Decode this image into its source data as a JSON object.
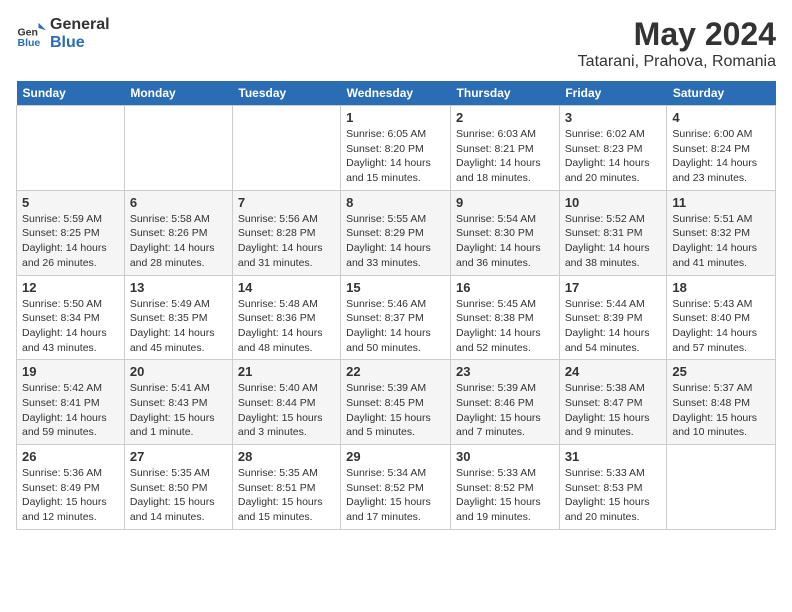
{
  "app": {
    "logo_general": "General",
    "logo_blue": "Blue",
    "title": "May 2024",
    "subtitle": "Tatarani, Prahova, Romania"
  },
  "calendar": {
    "headers": [
      "Sunday",
      "Monday",
      "Tuesday",
      "Wednesday",
      "Thursday",
      "Friday",
      "Saturday"
    ],
    "weeks": [
      [
        {
          "day": "",
          "sunrise": "",
          "sunset": "",
          "daylight": ""
        },
        {
          "day": "",
          "sunrise": "",
          "sunset": "",
          "daylight": ""
        },
        {
          "day": "",
          "sunrise": "",
          "sunset": "",
          "daylight": ""
        },
        {
          "day": "1",
          "sunrise": "Sunrise: 6:05 AM",
          "sunset": "Sunset: 8:20 PM",
          "daylight": "Daylight: 14 hours and 15 minutes."
        },
        {
          "day": "2",
          "sunrise": "Sunrise: 6:03 AM",
          "sunset": "Sunset: 8:21 PM",
          "daylight": "Daylight: 14 hours and 18 minutes."
        },
        {
          "day": "3",
          "sunrise": "Sunrise: 6:02 AM",
          "sunset": "Sunset: 8:23 PM",
          "daylight": "Daylight: 14 hours and 20 minutes."
        },
        {
          "day": "4",
          "sunrise": "Sunrise: 6:00 AM",
          "sunset": "Sunset: 8:24 PM",
          "daylight": "Daylight: 14 hours and 23 minutes."
        }
      ],
      [
        {
          "day": "5",
          "sunrise": "Sunrise: 5:59 AM",
          "sunset": "Sunset: 8:25 PM",
          "daylight": "Daylight: 14 hours and 26 minutes."
        },
        {
          "day": "6",
          "sunrise": "Sunrise: 5:58 AM",
          "sunset": "Sunset: 8:26 PM",
          "daylight": "Daylight: 14 hours and 28 minutes."
        },
        {
          "day": "7",
          "sunrise": "Sunrise: 5:56 AM",
          "sunset": "Sunset: 8:28 PM",
          "daylight": "Daylight: 14 hours and 31 minutes."
        },
        {
          "day": "8",
          "sunrise": "Sunrise: 5:55 AM",
          "sunset": "Sunset: 8:29 PM",
          "daylight": "Daylight: 14 hours and 33 minutes."
        },
        {
          "day": "9",
          "sunrise": "Sunrise: 5:54 AM",
          "sunset": "Sunset: 8:30 PM",
          "daylight": "Daylight: 14 hours and 36 minutes."
        },
        {
          "day": "10",
          "sunrise": "Sunrise: 5:52 AM",
          "sunset": "Sunset: 8:31 PM",
          "daylight": "Daylight: 14 hours and 38 minutes."
        },
        {
          "day": "11",
          "sunrise": "Sunrise: 5:51 AM",
          "sunset": "Sunset: 8:32 PM",
          "daylight": "Daylight: 14 hours and 41 minutes."
        }
      ],
      [
        {
          "day": "12",
          "sunrise": "Sunrise: 5:50 AM",
          "sunset": "Sunset: 8:34 PM",
          "daylight": "Daylight: 14 hours and 43 minutes."
        },
        {
          "day": "13",
          "sunrise": "Sunrise: 5:49 AM",
          "sunset": "Sunset: 8:35 PM",
          "daylight": "Daylight: 14 hours and 45 minutes."
        },
        {
          "day": "14",
          "sunrise": "Sunrise: 5:48 AM",
          "sunset": "Sunset: 8:36 PM",
          "daylight": "Daylight: 14 hours and 48 minutes."
        },
        {
          "day": "15",
          "sunrise": "Sunrise: 5:46 AM",
          "sunset": "Sunset: 8:37 PM",
          "daylight": "Daylight: 14 hours and 50 minutes."
        },
        {
          "day": "16",
          "sunrise": "Sunrise: 5:45 AM",
          "sunset": "Sunset: 8:38 PM",
          "daylight": "Daylight: 14 hours and 52 minutes."
        },
        {
          "day": "17",
          "sunrise": "Sunrise: 5:44 AM",
          "sunset": "Sunset: 8:39 PM",
          "daylight": "Daylight: 14 hours and 54 minutes."
        },
        {
          "day": "18",
          "sunrise": "Sunrise: 5:43 AM",
          "sunset": "Sunset: 8:40 PM",
          "daylight": "Daylight: 14 hours and 57 minutes."
        }
      ],
      [
        {
          "day": "19",
          "sunrise": "Sunrise: 5:42 AM",
          "sunset": "Sunset: 8:41 PM",
          "daylight": "Daylight: 14 hours and 59 minutes."
        },
        {
          "day": "20",
          "sunrise": "Sunrise: 5:41 AM",
          "sunset": "Sunset: 8:43 PM",
          "daylight": "Daylight: 15 hours and 1 minute."
        },
        {
          "day": "21",
          "sunrise": "Sunrise: 5:40 AM",
          "sunset": "Sunset: 8:44 PM",
          "daylight": "Daylight: 15 hours and 3 minutes."
        },
        {
          "day": "22",
          "sunrise": "Sunrise: 5:39 AM",
          "sunset": "Sunset: 8:45 PM",
          "daylight": "Daylight: 15 hours and 5 minutes."
        },
        {
          "day": "23",
          "sunrise": "Sunrise: 5:39 AM",
          "sunset": "Sunset: 8:46 PM",
          "daylight": "Daylight: 15 hours and 7 minutes."
        },
        {
          "day": "24",
          "sunrise": "Sunrise: 5:38 AM",
          "sunset": "Sunset: 8:47 PM",
          "daylight": "Daylight: 15 hours and 9 minutes."
        },
        {
          "day": "25",
          "sunrise": "Sunrise: 5:37 AM",
          "sunset": "Sunset: 8:48 PM",
          "daylight": "Daylight: 15 hours and 10 minutes."
        }
      ],
      [
        {
          "day": "26",
          "sunrise": "Sunrise: 5:36 AM",
          "sunset": "Sunset: 8:49 PM",
          "daylight": "Daylight: 15 hours and 12 minutes."
        },
        {
          "day": "27",
          "sunrise": "Sunrise: 5:35 AM",
          "sunset": "Sunset: 8:50 PM",
          "daylight": "Daylight: 15 hours and 14 minutes."
        },
        {
          "day": "28",
          "sunrise": "Sunrise: 5:35 AM",
          "sunset": "Sunset: 8:51 PM",
          "daylight": "Daylight: 15 hours and 15 minutes."
        },
        {
          "day": "29",
          "sunrise": "Sunrise: 5:34 AM",
          "sunset": "Sunset: 8:52 PM",
          "daylight": "Daylight: 15 hours and 17 minutes."
        },
        {
          "day": "30",
          "sunrise": "Sunrise: 5:33 AM",
          "sunset": "Sunset: 8:52 PM",
          "daylight": "Daylight: 15 hours and 19 minutes."
        },
        {
          "day": "31",
          "sunrise": "Sunrise: 5:33 AM",
          "sunset": "Sunset: 8:53 PM",
          "daylight": "Daylight: 15 hours and 20 minutes."
        },
        {
          "day": "",
          "sunrise": "",
          "sunset": "",
          "daylight": ""
        }
      ]
    ]
  }
}
